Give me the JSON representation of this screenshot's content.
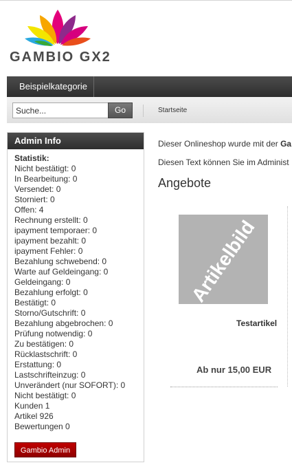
{
  "logo": {
    "text": "GAMBIO GX2"
  },
  "nav": {
    "category": "Beispielkategorie"
  },
  "search": {
    "placeholder": "Suche...",
    "go_label": "Go",
    "home_link": "Startseite"
  },
  "admin": {
    "title": "Admin Info",
    "stats_title": "Statistik:",
    "stats": [
      "Nicht bestätigt: 0",
      "In Bearbeitung: 0",
      "Versendet: 0",
      "Storniert: 0",
      "Offen: 4",
      "Rechnung erstellt: 0",
      "ipayment temporaer: 0",
      "ipayment bezahlt: 0",
      "ipayment Fehler: 0",
      "Bezahlung schwebend: 0",
      "Warte auf Geldeingang: 0",
      "Geldeingang: 0",
      "Bezahlung erfolgt: 0",
      "Bestätigt: 0",
      "Storno/Gutschrift: 0",
      "Bezahlung abgebrochen: 0",
      "Prüfung notwendig: 0",
      "Zu bestätigen: 0",
      "Rücklastschrift: 0",
      "Erstattung: 0",
      "Lastschrifteinzug: 0",
      "Unverändert (nur SOFORT): 0",
      "Nicht bestätigt: 0",
      "Kunden 1",
      "Artikel 926",
      "Bewertungen 0"
    ],
    "button_label": "Gambio Admin"
  },
  "content": {
    "intro_line1": "Dieser Onlineshop wurde mit der",
    "intro_line1_bold": "Ga",
    "intro_line2": "Diesen Text können Sie im Administ",
    "section_title": "Angebote"
  },
  "product": {
    "image_text": "Artikelbild",
    "name": "Testartikel",
    "price": "Ab nur 15,00 EUR"
  },
  "colors": {
    "nav_bg": "#3a3a3a",
    "admin_button": "#b00000",
    "placeholder_image": "#b3b3b3"
  }
}
